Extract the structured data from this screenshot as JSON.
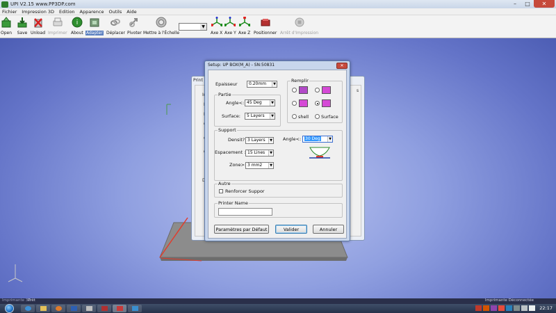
{
  "window": {
    "title": "UPI  V2.15 www.PP3DP.com",
    "minimize": "–",
    "maximize": "□",
    "close": "✕"
  },
  "menu": [
    "Fichier",
    "Impression 3D",
    "Edition",
    "Apparence",
    "Outils",
    "Aide"
  ],
  "toolbar": {
    "open": "Open",
    "save": "Save",
    "unload": "Unload",
    "imprimer": "Imprimer",
    "about": "About",
    "adapter": "Adapter",
    "deplacer": "Déplacer",
    "pivoter": "Pivoter",
    "mettre_echelle": "Mettre à l'Échelle",
    "axe_x": "Axe X",
    "axe_y": "Axe Y",
    "axe_z": "Axe Z",
    "positionner": "Positionner",
    "arret": "Arrêt d'Impression"
  },
  "print_window": {
    "title": "Print P",
    "fragments": [
      "Imp",
      "In",
      "Ép",
      "Qu",
      "du",
      "Op",
      "De"
    ],
    "side_glyph": "s"
  },
  "setup": {
    "title": "Setup: UP BOX(M_A) - SN:50831",
    "close": "✕",
    "epaisseur_label": "Epaisseur",
    "epaisseur_value": "0.20mm",
    "partie": {
      "label": "Partie",
      "angle_label": "Angle<:",
      "angle_value": "45 Deg",
      "surface_label": "Surface:",
      "surface_value": "5 Layers"
    },
    "remplir": {
      "label": "Remplir",
      "shell_label": "shell",
      "surface_label": "Surface"
    },
    "support": {
      "label": "Support",
      "densite_label": "Densit?",
      "densite_value": "3 Layers",
      "angle_label": "Angle<:",
      "angle_value": "30 Deg",
      "espacement_label": "Espacement :",
      "espacement_value": "15 Lines",
      "zone_label": "Zone>:",
      "zone_value": "3 mm2"
    },
    "autre": {
      "label": "Autre",
      "renforcer_label": "Renforcer Suppor"
    },
    "printer_name": {
      "label": "Printer Name",
      "value": ""
    },
    "buttons": {
      "defaults": "Paramètres par Défaut",
      "valider": "Valider",
      "annuler": "Annuler"
    }
  },
  "status": {
    "left": "Imprimante 3D",
    "ready": "Prêt",
    "printer": "Imprimante Déconnectée"
  },
  "clock": "22:17",
  "colors": {
    "viewport_center": "#b9c3ef",
    "viewport_edge": "#4a5bb2",
    "fill_icon": "#d54ad6",
    "selection": "#3399ff",
    "platform": "#8c8c8c",
    "axis_red": "#e23b2c",
    "dialog_frame": "#c8d6ec"
  }
}
